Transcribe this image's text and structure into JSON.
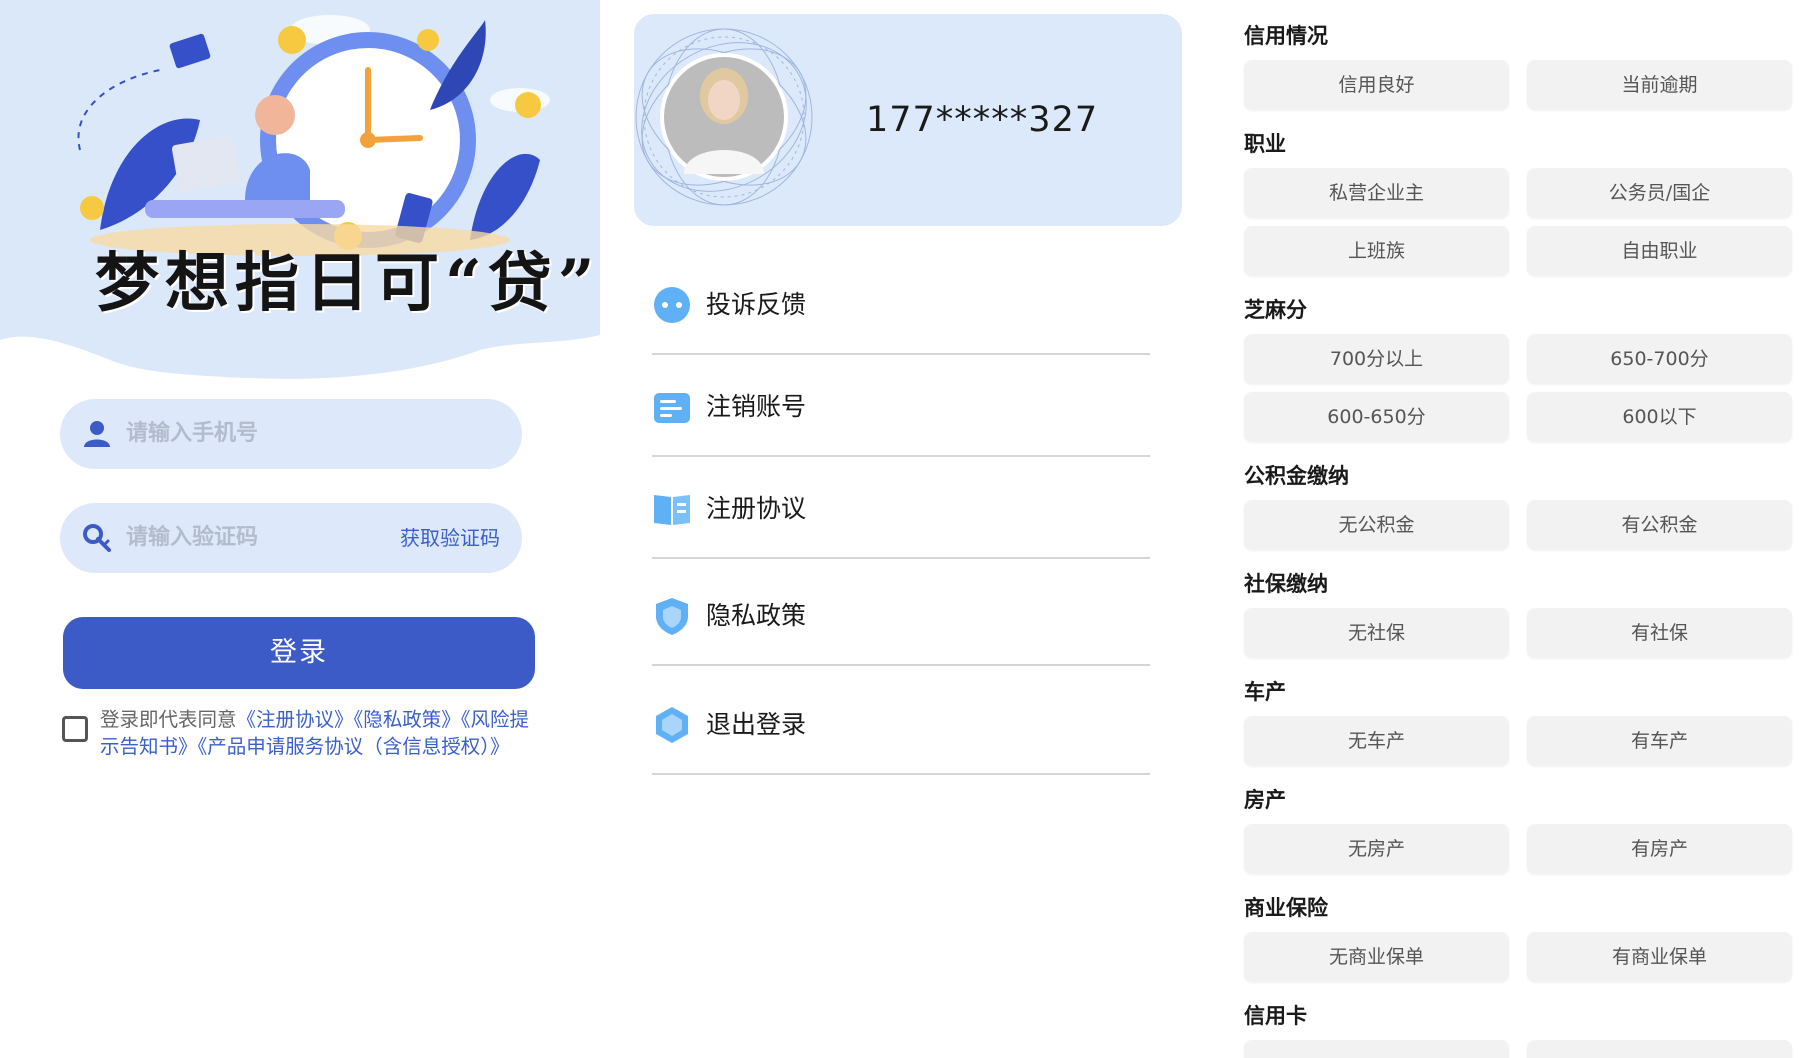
{
  "login": {
    "slogan": "梦想指日可“贷”",
    "phone_placeholder": "请输入手机号",
    "code_placeholder": "请输入验证码",
    "get_code_label": "获取验证码",
    "login_button": "登录",
    "agreement_prefix": "登录即代表同意",
    "agreement_link_1": "《注册协议》",
    "agreement_link_2": "《隐私政策》",
    "agreement_link_3": "《风险提示告知书》",
    "agreement_link_4": "《产品申请服务协议（含信息授权）》",
    "agreement_checked": false
  },
  "account": {
    "phone": "177*****327",
    "menu": [
      {
        "label": "投诉反馈",
        "icon": "chat-bubble-icon"
      },
      {
        "label": "注销账号",
        "icon": "card-icon"
      },
      {
        "label": "注册协议",
        "icon": "book-icon"
      },
      {
        "label": "隐私政策",
        "icon": "shield-icon"
      },
      {
        "label": "退出登录",
        "icon": "hexagon-icon"
      }
    ]
  },
  "filters": {
    "credit": {
      "title": "信用情况",
      "options": [
        "信用良好",
        "当前逾期"
      ]
    },
    "job": {
      "title": "职业",
      "options": [
        "私营企业主",
        "公务员/国企",
        "上班族",
        "自由职业"
      ]
    },
    "sesame": {
      "title": "芝麻分",
      "options": [
        "700分以上",
        "650-700分",
        "600-650分",
        "600以下"
      ]
    },
    "fund": {
      "title": "公积金缴纳",
      "options": [
        "无公积金",
        "有公积金"
      ]
    },
    "social": {
      "title": "社保缴纳",
      "options": [
        "无社保",
        "有社保"
      ]
    },
    "car": {
      "title": "车产",
      "options": [
        "无车产",
        "有车产"
      ]
    },
    "house": {
      "title": "房产",
      "options": [
        "无房产",
        "有房产"
      ]
    },
    "insurance": {
      "title": "商业保险",
      "options": [
        "无商业保单",
        "有商业保单"
      ]
    },
    "card": {
      "title": "信用卡"
    }
  },
  "colors": {
    "accent": "#3c5bc6",
    "field_bg": "#dde9fb",
    "card_bg": "#dce9fb",
    "chip_bg": "#f2f2f2",
    "link": "#3b5fc9"
  }
}
